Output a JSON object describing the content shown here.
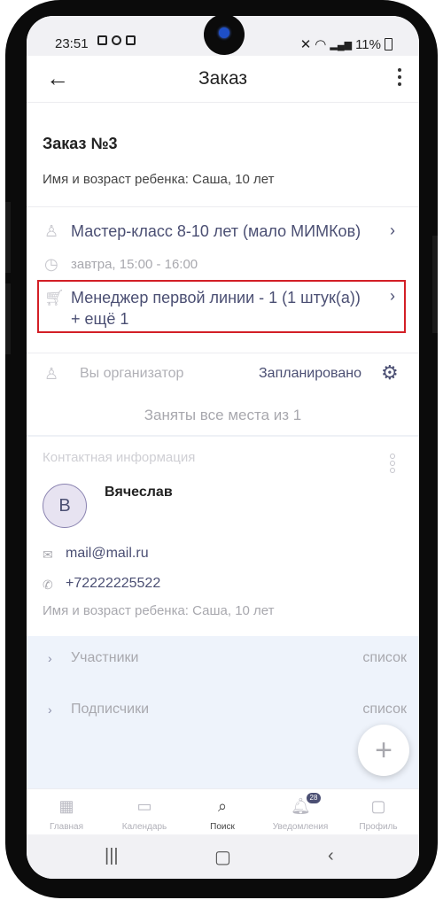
{
  "status_bar": {
    "time": "23:51",
    "battery": "11%"
  },
  "app_bar": {
    "title": "Заказ"
  },
  "order": {
    "title": "Заказ №3",
    "child_info": "Имя и возраст ребенка: Саша, 10 лет",
    "event": "Мастер-класс 8-10 лет (мало МИМКов)",
    "when": "завтра, 15:00 - 16:00",
    "item": "Менеджер первой линии - 1 (1 штук(а)) + ещё 1",
    "organizer_label": "Вы организатор",
    "status": "Запланировано",
    "seats": "Заняты все места из 1"
  },
  "contacts": {
    "header": "Контактная информация",
    "avatar_letter": "В",
    "name": "Вячеслав",
    "email": "mail@mail.ru",
    "phone": "+72222225522",
    "child_info": "Имя и возраст ребенка: Саша, 10 лет"
  },
  "lists": [
    {
      "label": "Участники",
      "action": "список"
    },
    {
      "label": "Подписчики",
      "action": "список"
    }
  ],
  "tabs": [
    {
      "label": "Главная",
      "icon": "grid-icon"
    },
    {
      "label": "Календарь",
      "icon": "calendar-icon"
    },
    {
      "label": "Поиск",
      "icon": "search-icon",
      "active": true
    },
    {
      "label": "Уведомления",
      "icon": "bell-icon",
      "badge": "28"
    },
    {
      "label": "Профиль",
      "icon": "profile-icon"
    }
  ],
  "colors": {
    "accent": "#4b4f73",
    "highlight_border": "#d31f26",
    "lists_bg": "#eef3fb"
  }
}
